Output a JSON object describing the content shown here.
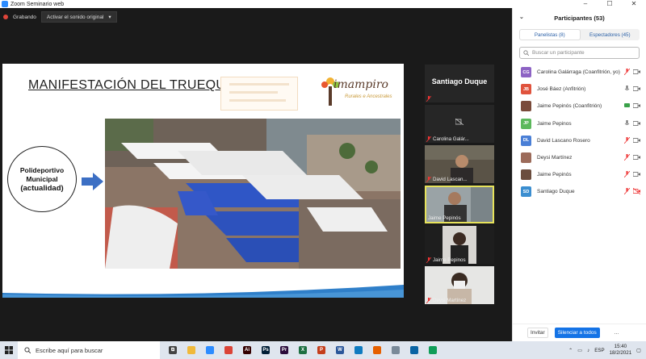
{
  "window": {
    "title": "Zoom Seminario web",
    "controls": [
      "–",
      "☐",
      "✕"
    ]
  },
  "recording": {
    "label": "Grabando",
    "audio_button": "Activar el sonido original",
    "audio_chevron": "▾"
  },
  "slide": {
    "title": "MANIFESTACIÓN DEL TRUEQUE",
    "logo_text": "imampiro",
    "logo_tagline": "Rurales e Ancestrales",
    "circle_line1": "Polideportivo",
    "circle_line2": "Municipal",
    "circle_line3": "(actualidad)"
  },
  "thumbnails": [
    {
      "name": "Santiago Duque",
      "muted": true,
      "type": "name-only"
    },
    {
      "name": "Carolina Galár...",
      "muted": true,
      "type": "video-off"
    },
    {
      "name": "David Lascan...",
      "muted": true,
      "type": "video"
    },
    {
      "name": "Jaime Pepinós",
      "muted": false,
      "type": "video",
      "active": true
    },
    {
      "name": "Jaime Pepinos",
      "muted": true,
      "type": "video"
    },
    {
      "name": "Deysi Martínez",
      "muted": true,
      "type": "video"
    }
  ],
  "sidebar": {
    "title": "Participantes (53)",
    "collapse_icon": "chevron-down-icon",
    "tabs": [
      {
        "label": "Panelistas (8)",
        "selected": true
      },
      {
        "label": "Espectadores (45)",
        "selected": false
      }
    ],
    "search_placeholder": "Buscar un participante",
    "participants": [
      {
        "initials": "CG",
        "color": "#8d63c4",
        "name": "Carolina Galárraga (Coanfitrión, yo)",
        "mic": "muted",
        "video": "on"
      },
      {
        "initials": "JB",
        "color": "#e0533d",
        "name": "José Báez (Anfitrión)",
        "mic": "on",
        "video": "on"
      },
      {
        "initials": "",
        "color": "#7a4a3a",
        "name": "Jaime Pepinós (Coanfitrión)",
        "mic": "share",
        "video": "on"
      },
      {
        "initials": "JP",
        "color": "#5cb85c",
        "name": "Jaime Pepinos",
        "mic": "on",
        "video": "on"
      },
      {
        "initials": "DL",
        "color": "#4a7fd6",
        "name": "David Lascano Rosero",
        "mic": "muted",
        "video": "on"
      },
      {
        "initials": "",
        "color": "#9c6b5a",
        "name": "Deysi Martínez",
        "mic": "muted",
        "video": "on"
      },
      {
        "initials": "",
        "color": "#6b4d3e",
        "name": "Jaime Pepinós",
        "mic": "muted",
        "video": "on"
      },
      {
        "initials": "SD",
        "color": "#3b8ed0",
        "name": "Santiago Duque",
        "mic": "muted",
        "video": "off"
      }
    ],
    "invite": "Invitar",
    "mute_all": "Silenciar a todos",
    "more": "..."
  },
  "taskbar": {
    "search_placeholder": "Escribe aquí para buscar",
    "apps": [
      {
        "name": "task-view-icon",
        "color": "#444",
        "glyph": "⧉"
      },
      {
        "name": "file-explorer-icon",
        "color": "#f0b93a",
        "glyph": ""
      },
      {
        "name": "zoom-icon",
        "color": "#2d8cff",
        "glyph": ""
      },
      {
        "name": "chrome-icon",
        "color": "#db4437",
        "glyph": ""
      },
      {
        "name": "illustrator-icon",
        "color": "#330000",
        "glyph": "Ai"
      },
      {
        "name": "photoshop-icon",
        "color": "#001e36",
        "glyph": "Ps"
      },
      {
        "name": "premiere-icon",
        "color": "#2a0a3a",
        "glyph": "Pr"
      },
      {
        "name": "excel-icon",
        "color": "#1d6f42",
        "glyph": "X"
      },
      {
        "name": "powerpoint-icon",
        "color": "#c43e1c",
        "glyph": "P"
      },
      {
        "name": "word-icon",
        "color": "#2b579a",
        "glyph": "W"
      },
      {
        "name": "edge-icon",
        "color": "#0f7bc0",
        "glyph": ""
      },
      {
        "name": "firefox-icon",
        "color": "#e66000",
        "glyph": ""
      },
      {
        "name": "tools-icon",
        "color": "#7a8a99",
        "glyph": ""
      },
      {
        "name": "photos-icon",
        "color": "#0a64a4",
        "glyph": ""
      },
      {
        "name": "chrome-icon-2",
        "color": "#0f9d58",
        "glyph": ""
      }
    ],
    "tray": {
      "language": "ESP",
      "time": "15:40",
      "date": "18/2/2021"
    }
  }
}
